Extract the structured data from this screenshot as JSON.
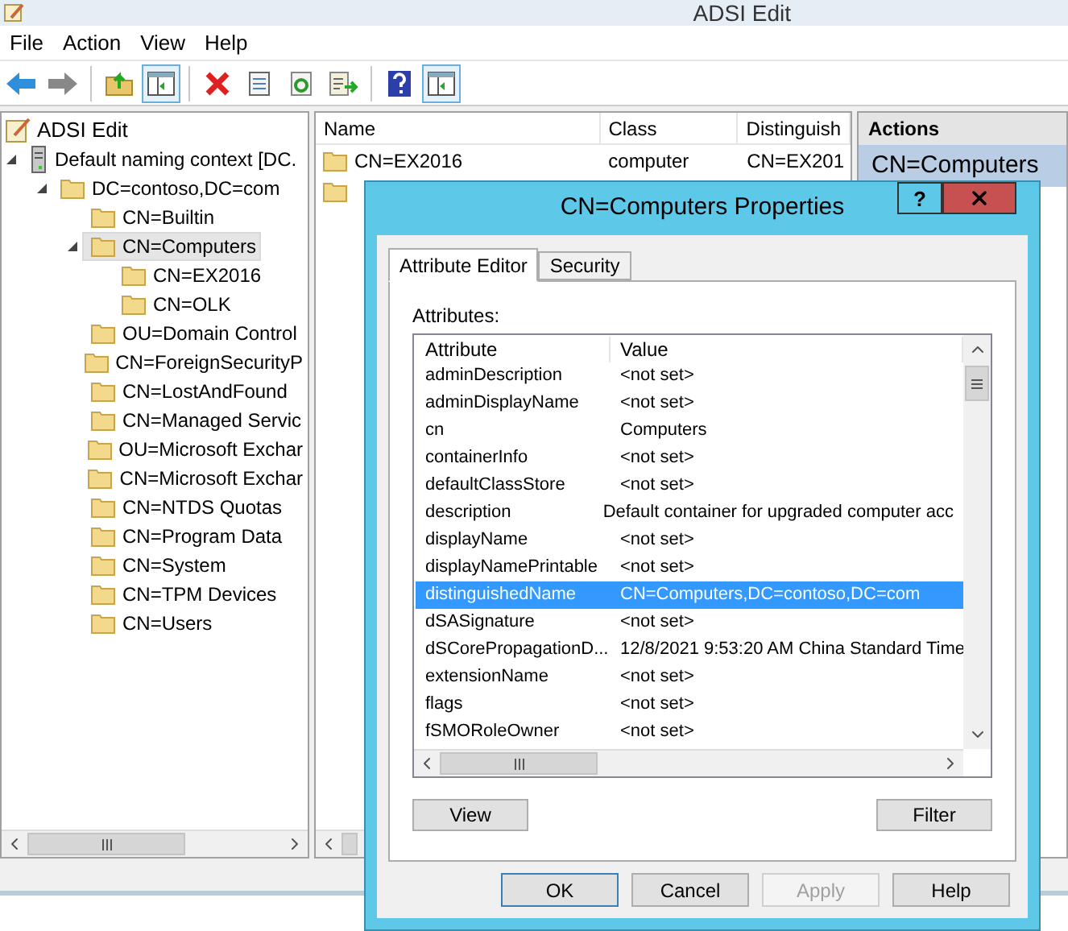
{
  "window": {
    "title": "ADSI Edit"
  },
  "menu": [
    "File",
    "Action",
    "View",
    "Help"
  ],
  "toolbar": [
    {
      "kind": "back",
      "pressed": false
    },
    {
      "kind": "forward",
      "pressed": false
    },
    {
      "kind": "sep"
    },
    {
      "kind": "up",
      "pressed": false
    },
    {
      "kind": "pane",
      "pressed": true
    },
    {
      "kind": "sep"
    },
    {
      "kind": "delete",
      "pressed": false
    },
    {
      "kind": "properties",
      "pressed": false
    },
    {
      "kind": "refresh",
      "pressed": false
    },
    {
      "kind": "export",
      "pressed": false
    },
    {
      "kind": "sep"
    },
    {
      "kind": "help",
      "pressed": false
    },
    {
      "kind": "pane",
      "pressed": true
    }
  ],
  "tree": {
    "root": "ADSI Edit",
    "children": [
      {
        "label": "Default naming context [DC.",
        "kind": "server",
        "selected": false,
        "children": [
          {
            "label": "DC=contoso,DC=com",
            "kind": "folder",
            "selected": false,
            "children": [
              {
                "label": "CN=Builtin",
                "kind": "folder",
                "selected": false
              },
              {
                "label": "CN=Computers",
                "kind": "folder",
                "selected": true,
                "children": [
                  {
                    "label": "CN=EX2016",
                    "kind": "folder",
                    "selected": false
                  },
                  {
                    "label": "CN=OLK",
                    "kind": "folder",
                    "selected": false
                  }
                ]
              },
              {
                "label": "OU=Domain Control",
                "kind": "folder",
                "selected": false
              },
              {
                "label": "CN=ForeignSecurityP",
                "kind": "folder",
                "selected": false
              },
              {
                "label": "CN=LostAndFound",
                "kind": "folder",
                "selected": false
              },
              {
                "label": "CN=Managed Servic",
                "kind": "folder",
                "selected": false
              },
              {
                "label": "OU=Microsoft Exchar",
                "kind": "folder",
                "selected": false
              },
              {
                "label": "CN=Microsoft Exchar",
                "kind": "folder",
                "selected": false
              },
              {
                "label": "CN=NTDS Quotas",
                "kind": "folder",
                "selected": false
              },
              {
                "label": "CN=Program Data",
                "kind": "folder",
                "selected": false
              },
              {
                "label": "CN=System",
                "kind": "folder",
                "selected": false
              },
              {
                "label": "CN=TPM Devices",
                "kind": "folder",
                "selected": false
              },
              {
                "label": "CN=Users",
                "kind": "folder",
                "selected": false
              }
            ]
          }
        ]
      }
    ]
  },
  "list": {
    "columns": [
      "Name",
      "Class",
      "Distinguish"
    ],
    "rows": [
      {
        "kind": "folder",
        "cells": [
          "CN=EX2016",
          "computer",
          "CN=EX201"
        ]
      },
      {
        "kind": "folder"
      }
    ]
  },
  "actions": {
    "header": "Actions",
    "items": [
      {
        "label": "CN=Computers",
        "selected": true
      }
    ]
  },
  "dialog": {
    "title": "CN=Computers Properties",
    "help": "?",
    "tabs": [
      {
        "label": "Attribute Editor",
        "selected": true
      },
      {
        "label": "Security",
        "selected": false
      }
    ],
    "attributes_label": "Attributes:",
    "columns": [
      "Attribute",
      "Value"
    ],
    "rows": [
      {
        "attribute": "adminDescription",
        "value": "<not set>",
        "selected": false
      },
      {
        "attribute": "adminDisplayName",
        "value": "<not set>",
        "selected": false
      },
      {
        "attribute": "cn",
        "value": "Computers",
        "selected": false
      },
      {
        "attribute": "containerInfo",
        "value": "<not set>",
        "selected": false
      },
      {
        "attribute": "defaultClassStore",
        "value": "<not set>",
        "selected": false
      },
      {
        "attribute": "description",
        "value": "Default container for upgraded computer acc",
        "selected": false
      },
      {
        "attribute": "displayName",
        "value": "<not set>",
        "selected": false
      },
      {
        "attribute": "displayNamePrintable",
        "value": "<not set>",
        "selected": false
      },
      {
        "attribute": "distinguishedName",
        "value": "CN=Computers,DC=contoso,DC=com",
        "selected": true
      },
      {
        "attribute": "dSASignature",
        "value": "<not set>",
        "selected": false
      },
      {
        "attribute": "dSCorePropagationD...",
        "value": "12/8/2021 9:53:20 AM China Standard Time",
        "selected": false
      },
      {
        "attribute": "extensionName",
        "value": "<not set>",
        "selected": false
      },
      {
        "attribute": "flags",
        "value": "<not set>",
        "selected": false
      },
      {
        "attribute": "fSMORoleOwner",
        "value": "<not set>",
        "selected": false
      }
    ],
    "view_button": "View",
    "filter_button": "Filter",
    "footer_buttons": [
      {
        "label": "OK",
        "disabled": false,
        "default": true
      },
      {
        "label": "Cancel",
        "disabled": false,
        "default": false
      },
      {
        "label": "Apply",
        "disabled": true,
        "default": false
      },
      {
        "label": "Help",
        "disabled": false,
        "default": false
      }
    ]
  }
}
